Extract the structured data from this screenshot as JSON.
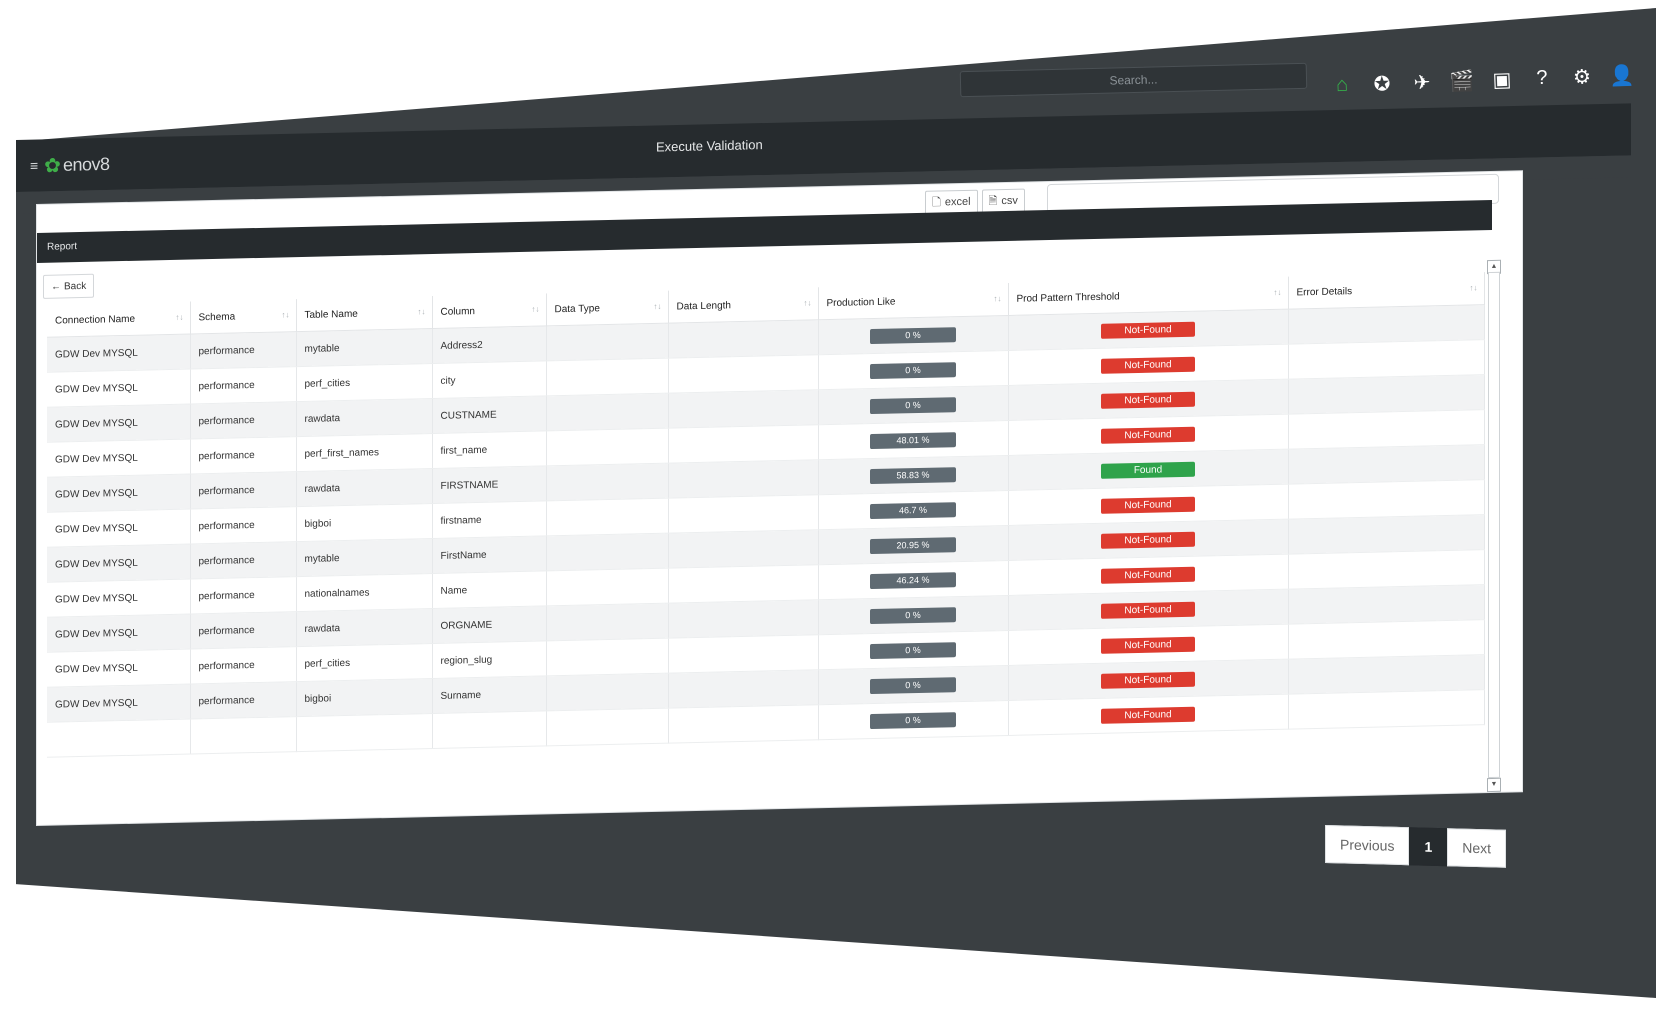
{
  "header": {
    "search_placeholder": "Search...",
    "icons": [
      "home-icon",
      "star-icon",
      "paper-plane-icon",
      "clapperboard-icon",
      "presentation-icon",
      "help-icon",
      "gear-icon",
      "user-icon"
    ],
    "logo_text": "enov8",
    "page_title": "Execute Validation"
  },
  "report": {
    "heading": "Report",
    "back_label": "Back",
    "export_excel": "excel",
    "export_csv": "csv",
    "columns": [
      "Connection Name",
      "Schema",
      "Table Name",
      "Column",
      "Data Type",
      "Data Length",
      "Production Like",
      "Prod Pattern Threshold",
      "Error Details"
    ],
    "rows": [
      {
        "conn": "GDW Dev MYSQL",
        "schema": "performance",
        "table": "mytable",
        "column": "Address2",
        "type": "",
        "length": "",
        "prod": "0 %",
        "threshold": "Not-Found",
        "error": ""
      },
      {
        "conn": "GDW Dev MYSQL",
        "schema": "performance",
        "table": "perf_cities",
        "column": "city",
        "type": "",
        "length": "",
        "prod": "0 %",
        "threshold": "Not-Found",
        "error": ""
      },
      {
        "conn": "GDW Dev MYSQL",
        "schema": "performance",
        "table": "rawdata",
        "column": "CUSTNAME",
        "type": "",
        "length": "",
        "prod": "0 %",
        "threshold": "Not-Found",
        "error": ""
      },
      {
        "conn": "GDW Dev MYSQL",
        "schema": "performance",
        "table": "perf_first_names",
        "column": "first_name",
        "type": "",
        "length": "",
        "prod": "48.01 %",
        "threshold": "Not-Found",
        "error": ""
      },
      {
        "conn": "GDW Dev MYSQL",
        "schema": "performance",
        "table": "rawdata",
        "column": "FIRSTNAME",
        "type": "",
        "length": "",
        "prod": "58.83 %",
        "threshold": "Found",
        "error": ""
      },
      {
        "conn": "GDW Dev MYSQL",
        "schema": "performance",
        "table": "bigboi",
        "column": "firstname",
        "type": "",
        "length": "",
        "prod": "46.7 %",
        "threshold": "Not-Found",
        "error": ""
      },
      {
        "conn": "GDW Dev MYSQL",
        "schema": "performance",
        "table": "mytable",
        "column": "FirstName",
        "type": "",
        "length": "",
        "prod": "20.95 %",
        "threshold": "Not-Found",
        "error": ""
      },
      {
        "conn": "GDW Dev MYSQL",
        "schema": "performance",
        "table": "nationalnames",
        "column": "Name",
        "type": "",
        "length": "",
        "prod": "46.24 %",
        "threshold": "Not-Found",
        "error": ""
      },
      {
        "conn": "GDW Dev MYSQL",
        "schema": "performance",
        "table": "rawdata",
        "column": "ORGNAME",
        "type": "",
        "length": "",
        "prod": "0 %",
        "threshold": "Not-Found",
        "error": ""
      },
      {
        "conn": "GDW Dev MYSQL",
        "schema": "performance",
        "table": "perf_cities",
        "column": "region_slug",
        "type": "",
        "length": "",
        "prod": "0 %",
        "threshold": "Not-Found",
        "error": ""
      },
      {
        "conn": "GDW Dev MYSQL",
        "schema": "performance",
        "table": "bigboi",
        "column": "Surname",
        "type": "",
        "length": "",
        "prod": "0 %",
        "threshold": "Not-Found",
        "error": ""
      },
      {
        "conn": "",
        "schema": "",
        "table": "",
        "column": "",
        "type": "",
        "length": "",
        "prod": "0 %",
        "threshold": "Not-Found",
        "error": ""
      }
    ]
  },
  "pagination": {
    "previous": "Previous",
    "current": "1",
    "next": "Next"
  },
  "colors": {
    "accent_green": "#35b34a",
    "not_found": "#dd3b2f",
    "found": "#2fa34b",
    "header_dark": "#262b2e"
  }
}
